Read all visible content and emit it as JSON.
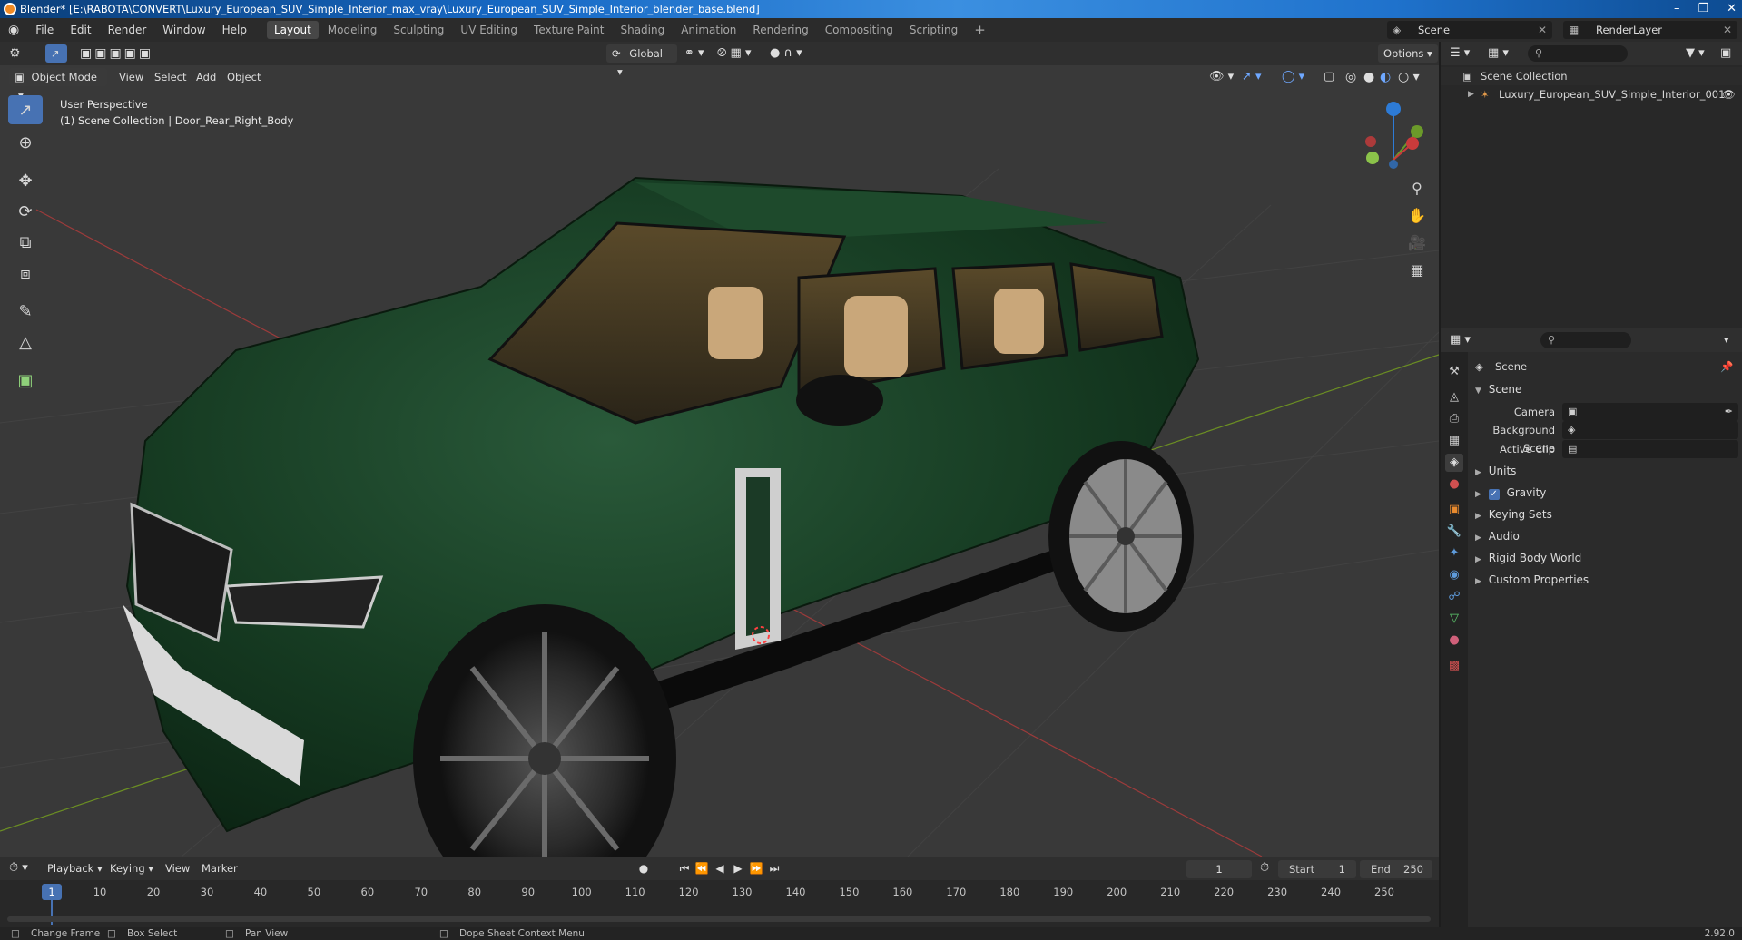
{
  "window": {
    "title": "Blender* [E:\\RABOTA\\CONVERT\\Luxury_European_SUV_Simple_Interior_max_vray\\Luxury_European_SUV_Simple_Interior_blender_base.blend]",
    "min": "–",
    "restore": "❐",
    "close": "✕"
  },
  "menu": {
    "file": "File",
    "edit": "Edit",
    "render": "Render",
    "window": "Window",
    "help": "Help"
  },
  "workspaces": [
    "Layout",
    "Modeling",
    "Sculpting",
    "UV Editing",
    "Texture Paint",
    "Shading",
    "Animation",
    "Rendering",
    "Compositing",
    "Scripting"
  ],
  "add_workspace": "+",
  "scene_selector": "Scene",
  "render_layer": "RenderLayer",
  "viewport": {
    "mode": "Object Mode",
    "menus": {
      "view": "View",
      "select": "Select",
      "add": "Add",
      "object": "Object"
    },
    "transform_orientation": "Global",
    "options": "Options",
    "perspective_label": "User Perspective",
    "context_label": "(1) Scene Collection | Door_Rear_Right_Body",
    "gizmo": {
      "z": "Z",
      "y": "Y",
      "x": "X"
    },
    "colors": {
      "background": "#393939",
      "grid_red": "#9c3b3b",
      "grid_green": "#6b8e23",
      "car_body": "#163b22",
      "active_tool": "#4772b3"
    }
  },
  "outliner": {
    "scene_collection": "Scene Collection",
    "object": "Luxury_European_SUV_Simple_Interior_001"
  },
  "properties": {
    "context": "Scene",
    "panel": "Scene",
    "camera_label": "Camera",
    "background_scene_label": "Background Scene",
    "active_clip_label": "Active Clip",
    "sections": [
      "Units",
      "Gravity",
      "Keying Sets",
      "Audio",
      "Rigid Body World",
      "Custom Properties"
    ],
    "gravity_checked": true
  },
  "timeline": {
    "menus": {
      "playback": "Playback",
      "keying": "Keying",
      "view": "View",
      "marker": "Marker"
    },
    "current_frame": "1",
    "start_label": "Start",
    "start": "1",
    "end_label": "End",
    "end": "250",
    "ticks": [
      "1",
      "10",
      "20",
      "30",
      "40",
      "50",
      "60",
      "70",
      "80",
      "90",
      "100",
      "110",
      "120",
      "130",
      "140",
      "150",
      "160",
      "170",
      "180",
      "190",
      "200",
      "210",
      "220",
      "230",
      "240",
      "250"
    ]
  },
  "status": {
    "change_frame": "Change Frame",
    "box_select": "Box Select",
    "pan_view": "Pan View",
    "context_menu": "Dope Sheet Context Menu",
    "version": "2.92.0"
  }
}
